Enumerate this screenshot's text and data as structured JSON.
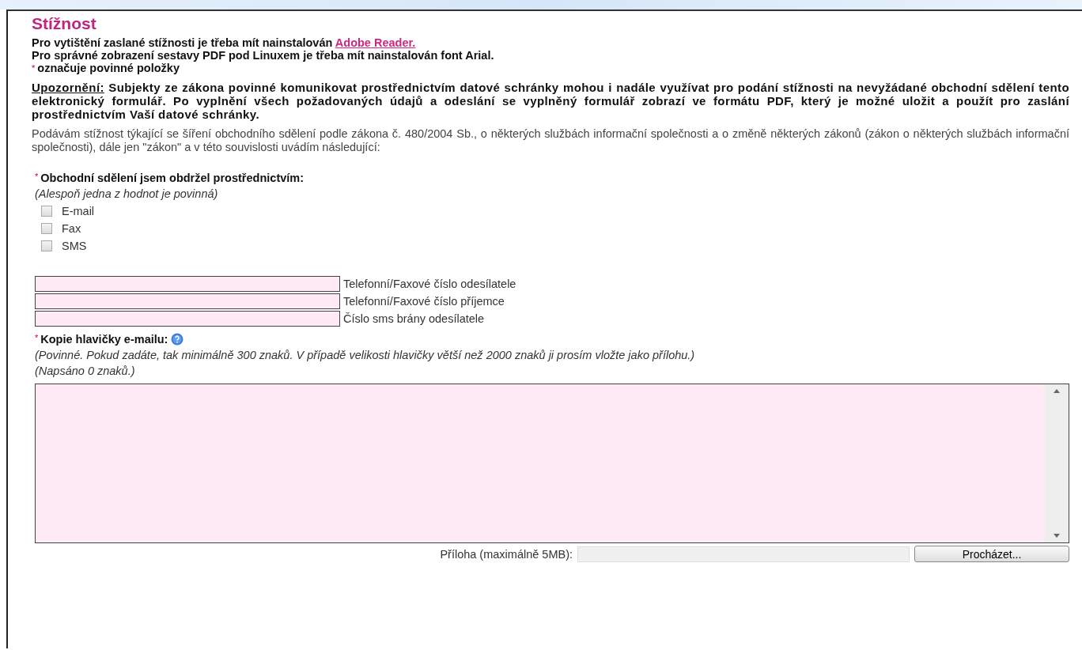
{
  "title": "Stížnost",
  "intro": {
    "text": "Pro vytištění zaslané stížnosti je třeba mít nainstalován ",
    "link": "Adobe Reader."
  },
  "font_note": "Pro správné zobrazení sestavy PDF pod Linuxem je třeba mít nainstalován font Arial.",
  "required_note": {
    "mark": "*",
    "text": "označuje povinné položky"
  },
  "warning": {
    "label": "Upozornění:",
    "text": "Subjekty ze zákona povinné komunikovat prostřednictvím datové schránky mohou i nadále využívat pro podání stížnosti na nevyžádané obchodní sdělení tento elektronický formulář. Po vyplnění všech požadovaných údajů a odeslání se vyplněný formulář zobrazí ve formátu PDF, který je možné uložit a použít pro zaslání prostřednictvím Vaší datové schránky."
  },
  "description": "Podávám stížnost týkající se šíření obchodního sdělení podle zákona č. 480/2004 Sb., o některých službách informační společnosti a o změně některých zákonů (zákon o některých službách informační společnosti), dále jen \"zákon\" a v této souvislosti uvádím následující:",
  "channel_section": {
    "mark": "*",
    "label": "Obchodní sdělení jsem obdržel prostřednictvím:",
    "hint": "(Alespoň jedna z hodnot je povinná)",
    "checkboxes": [
      {
        "label": "E-mail",
        "checked": false
      },
      {
        "label": "Fax",
        "checked": false
      },
      {
        "label": "SMS",
        "checked": false
      }
    ]
  },
  "number_fields": [
    {
      "label": "Telefonní/Faxové číslo odesílatele"
    },
    {
      "label": "Telefonní/Faxové číslo příjemce"
    },
    {
      "label": "Číslo sms brány odesílatele"
    }
  ],
  "header_section": {
    "mark": "*",
    "label": "Kopie hlavičky e-mailu:",
    "hint": "(Povinné. Pokud zadáte, tak minimálně 300 znaků. V případě velikosti hlavičky větší než 2000 znaků ji prosím vložte jako přílohu.)",
    "count": "(Napsáno 0 znaků.)"
  },
  "attachment": {
    "label": "Příloha (maximálně 5MB):",
    "button": "Procházet..."
  }
}
